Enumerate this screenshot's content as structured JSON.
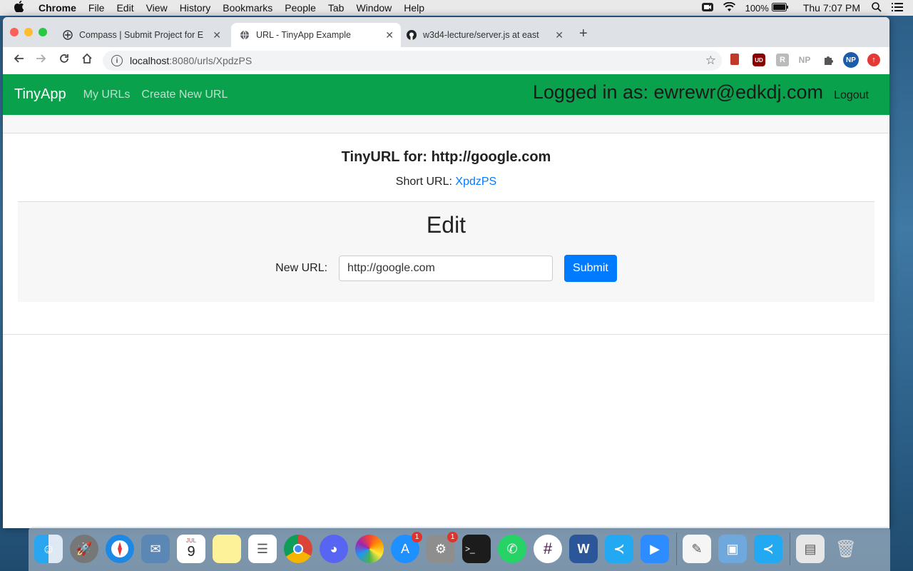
{
  "menubar": {
    "app": "Chrome",
    "items": [
      "File",
      "Edit",
      "View",
      "History",
      "Bookmarks",
      "People",
      "Tab",
      "Window",
      "Help"
    ],
    "battery": "100%",
    "clock": "Thu 7:07 PM"
  },
  "tabs": [
    {
      "title": "Compass | Submit Project for E",
      "icon": "compass-icon"
    },
    {
      "title": "URL - TinyApp Example",
      "icon": "globe-icon"
    },
    {
      "title": "w3d4-lecture/server.js at east",
      "icon": "github-icon"
    }
  ],
  "address": {
    "host": "localhost",
    "path": ":8080/urls/XpdzPS"
  },
  "extensions": [
    "UD",
    "NP"
  ],
  "navbar": {
    "brand": "TinyApp",
    "links": [
      "My URLs",
      "Create New URL"
    ],
    "logged_in": "Logged in as: ewrewr@edkdj.com",
    "logout": "Logout"
  },
  "page": {
    "title": "TinyURL for: http://google.com",
    "short_label": "Short URL:",
    "short_value": "XpdzPS",
    "edit_heading": "Edit",
    "new_url_label": "New URL:",
    "new_url_value": "http://google.com",
    "submit": "Submit"
  },
  "dock": {
    "apps": [
      "finder",
      "launchpad",
      "safari",
      "mail",
      "calendar",
      "notes",
      "reminders",
      "chrome",
      "discord",
      "photos",
      "app-store",
      "system-preferences",
      "terminal",
      "whatsapp",
      "slack",
      "word",
      "vscode",
      "zoom",
      "textedit",
      "preview",
      "vscode-2",
      "file",
      "trash"
    ],
    "calendar_month": "JUL",
    "calendar_day": "9",
    "badges": {
      "app_store": "1",
      "system_preferences": "1"
    }
  }
}
